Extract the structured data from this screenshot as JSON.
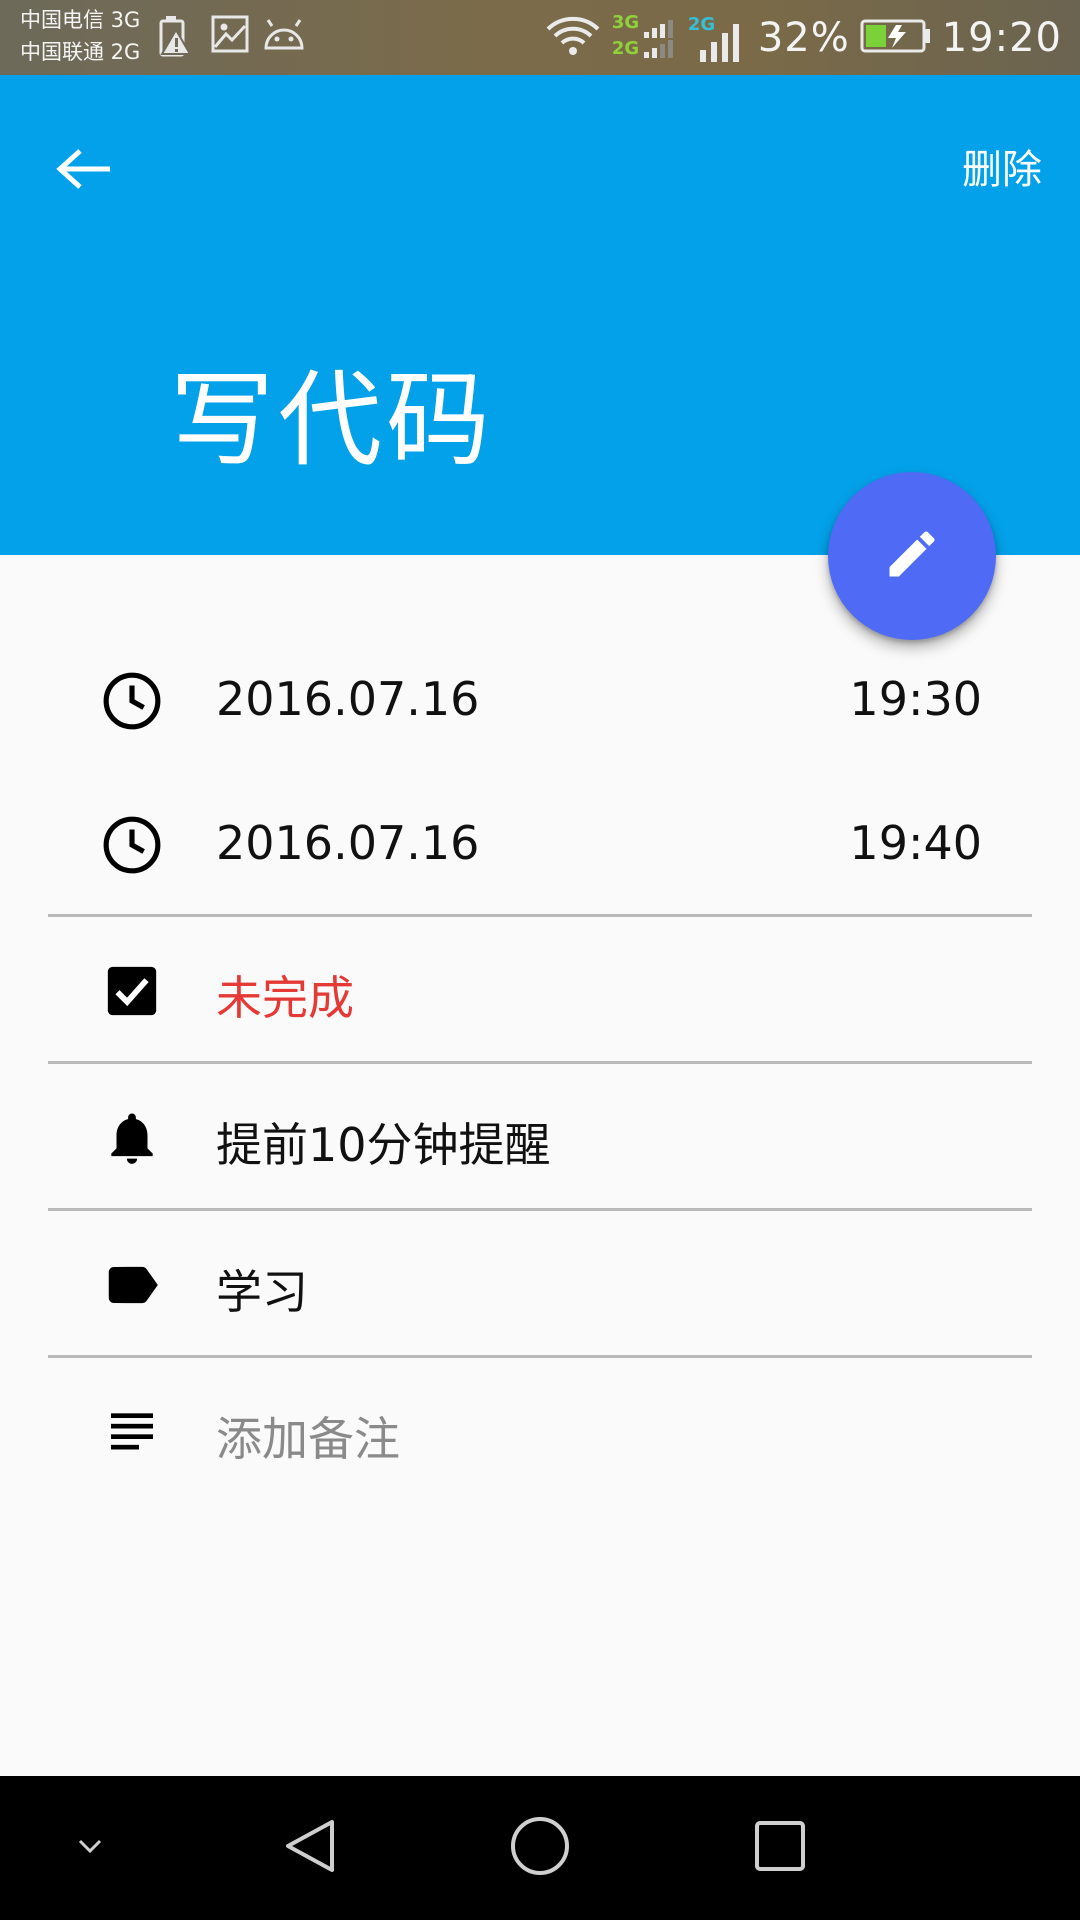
{
  "status_bar": {
    "carrier_1": "中国电信 3G",
    "carrier_2": "中国联通 2G",
    "network_1": "3G",
    "network_2": "2G",
    "network_3": "2G",
    "battery_percent": "32%",
    "time": "19:20",
    "icons": [
      "battery-alert-icon",
      "image-icon",
      "android-icon",
      "wifi-icon",
      "signal-icon",
      "battery-charging-icon"
    ]
  },
  "app_bar": {
    "back_icon": "arrow-back-icon",
    "delete_label": "删除",
    "title": "写代码",
    "color": "#03a1e9"
  },
  "fab": {
    "icon": "edit-pencil-icon",
    "color": "#4f6bf5"
  },
  "details": {
    "start": {
      "icon": "clock-icon",
      "date": "2016.07.16",
      "time": "19:30"
    },
    "end": {
      "icon": "clock-icon",
      "date": "2016.07.16",
      "time": "19:40"
    },
    "status": {
      "icon": "checkbox-checked-icon",
      "label": "未完成",
      "color": "#e53935"
    },
    "reminder": {
      "icon": "bell-icon",
      "label": "提前10分钟提醒"
    },
    "category": {
      "icon": "label-tag-icon",
      "label": "学习"
    },
    "note": {
      "icon": "notes-icon",
      "placeholder": "添加备注"
    }
  },
  "nav_bar": {
    "icons": [
      "chevron-down-icon",
      "back-triangle-icon",
      "home-circle-icon",
      "recents-square-icon"
    ]
  }
}
